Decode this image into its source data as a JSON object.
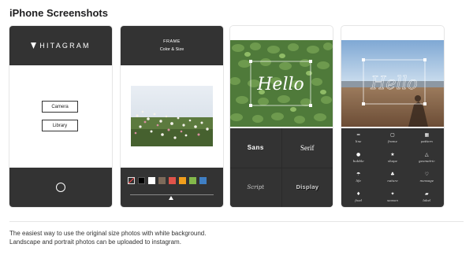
{
  "page": {
    "title": "iPhone Screenshots"
  },
  "screen1": {
    "logo": "HITAGRAM",
    "buttons": [
      "Camera",
      "Library"
    ]
  },
  "screen2": {
    "header_line1": "FRAME",
    "header_line2": "Color & Size",
    "swatches": [
      "#ffffff",
      "#000000",
      "#ffffff",
      "#7d6a5a",
      "#e0534a",
      "#f19e1c",
      "#83b84a",
      "#3f7fc4"
    ]
  },
  "screen3": {
    "overlay_text": "Hello",
    "fonts": [
      "Sans",
      "Serif",
      "Script",
      "Display"
    ]
  },
  "screen4": {
    "overlay_text": "Hello",
    "icons": [
      {
        "label": "line",
        "icon": "line-icon"
      },
      {
        "label": "frame",
        "icon": "frame-icon"
      },
      {
        "label": "pattern",
        "icon": "pattern-icon"
      },
      {
        "label": "bubble",
        "icon": "bubble-icon"
      },
      {
        "label": "shape",
        "icon": "shape-icon"
      },
      {
        "label": "geometric",
        "icon": "geometric-icon"
      },
      {
        "label": "life",
        "icon": "life-icon"
      },
      {
        "label": "nature",
        "icon": "nature-icon"
      },
      {
        "label": "message",
        "icon": "message-icon"
      },
      {
        "label": "food",
        "icon": "food-icon"
      },
      {
        "label": "season",
        "icon": "season-icon"
      },
      {
        "label": "label",
        "icon": "label-icon"
      }
    ]
  },
  "description": [
    "The easiest way to use the original size photos with white background.",
    "Landscape and portrait photos can be uploaded to instagram."
  ]
}
